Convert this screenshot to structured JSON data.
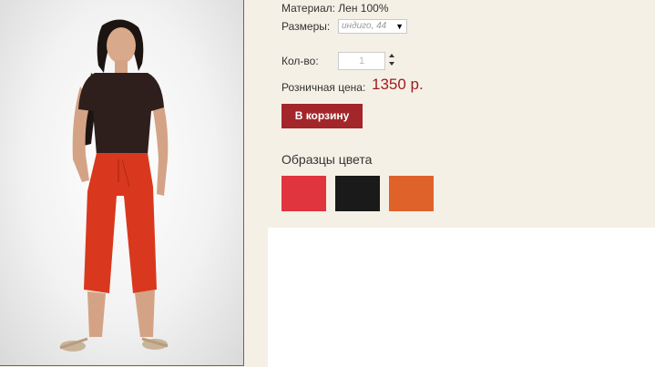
{
  "product": {
    "material": "Материал: Лен 100%",
    "sizes_label": "Размеры:",
    "size_selected": "индиго, 44",
    "qty_label": "Кол-во:",
    "qty_value": "1",
    "price_label": "Розничная цена:",
    "price_value": "1350 р.",
    "cart_button_label": "В корзину",
    "swatches_title": "Образцы цвета"
  },
  "colors": {
    "price": "#9e1b1b",
    "button": "#a3262b",
    "background": "#f5f0e6",
    "swatches": [
      "#e0343f",
      "#1a1a1a",
      "#e0622b"
    ]
  }
}
